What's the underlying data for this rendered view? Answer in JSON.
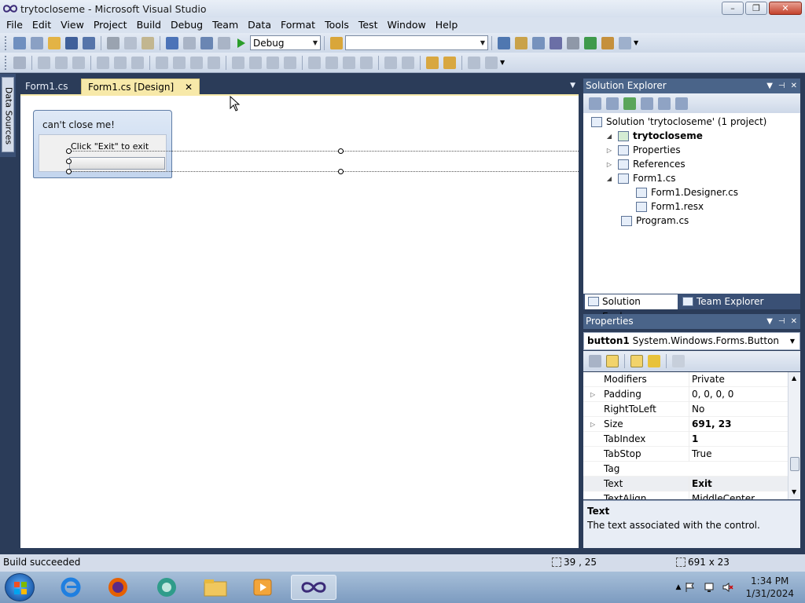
{
  "window": {
    "title": "trytocloseme - Microsoft Visual Studio",
    "minimize": "–",
    "restore": "❐",
    "close": "✕"
  },
  "menu": [
    "File",
    "Edit",
    "View",
    "Project",
    "Build",
    "Debug",
    "Team",
    "Data",
    "Format",
    "Tools",
    "Test",
    "Window",
    "Help"
  ],
  "toolbar": {
    "config_value": "Debug",
    "platform_value": ""
  },
  "left_dock": {
    "data_sources_label": "Data Sources"
  },
  "doc_tabs": [
    {
      "label": "Form1.cs"
    },
    {
      "label": "Form1.cs [Design]",
      "close": "✕"
    }
  ],
  "designer": {
    "form_title": "can't close me!",
    "label_text": "Click \"Exit\" to exit"
  },
  "solution_explorer": {
    "title": "Solution Explorer",
    "tree": [
      {
        "label": "Solution 'trytocloseme' (1 project)",
        "exp": ""
      },
      {
        "label": "trytocloseme",
        "exp": "◢"
      },
      {
        "label": "Properties",
        "exp": "▷"
      },
      {
        "label": "References",
        "exp": "▷"
      },
      {
        "label": "Form1.cs",
        "exp": "◢"
      },
      {
        "label": "Form1.Designer.cs",
        "exp": ""
      },
      {
        "label": "Form1.resx",
        "exp": ""
      },
      {
        "label": "Program.cs",
        "exp": ""
      }
    ],
    "tabs": [
      "Solution Explorer",
      "Team Explorer"
    ]
  },
  "properties": {
    "title": "Properties",
    "object_name": "button1",
    "object_type": "System.Windows.Forms.Button",
    "rows": [
      {
        "name": "Modifiers",
        "value": "Private",
        "exp": ""
      },
      {
        "name": "Padding",
        "value": "0, 0, 0, 0",
        "exp": "▷"
      },
      {
        "name": "RightToLeft",
        "value": "No",
        "exp": ""
      },
      {
        "name": "Size",
        "value": "691, 23",
        "exp": "▷"
      },
      {
        "name": "TabIndex",
        "value": "1",
        "exp": ""
      },
      {
        "name": "TabStop",
        "value": "True",
        "exp": ""
      },
      {
        "name": "Tag",
        "value": "",
        "exp": ""
      },
      {
        "name": "Text",
        "value": "Exit",
        "exp": ""
      },
      {
        "name": "TextAlign",
        "value": "MiddleCenter",
        "exp": ""
      }
    ],
    "desc_title": "Text",
    "desc_text": "The text associated with the control."
  },
  "status": {
    "text": "Build succeeded",
    "position": "39 , 25",
    "size": "691 x 23"
  },
  "taskbar": {
    "time": "1:34 PM",
    "date": "1/31/2024"
  },
  "colors": {
    "accent": "#4a6489",
    "active_tab": "#f7e9a9",
    "ide_background": "#2b3c59"
  }
}
